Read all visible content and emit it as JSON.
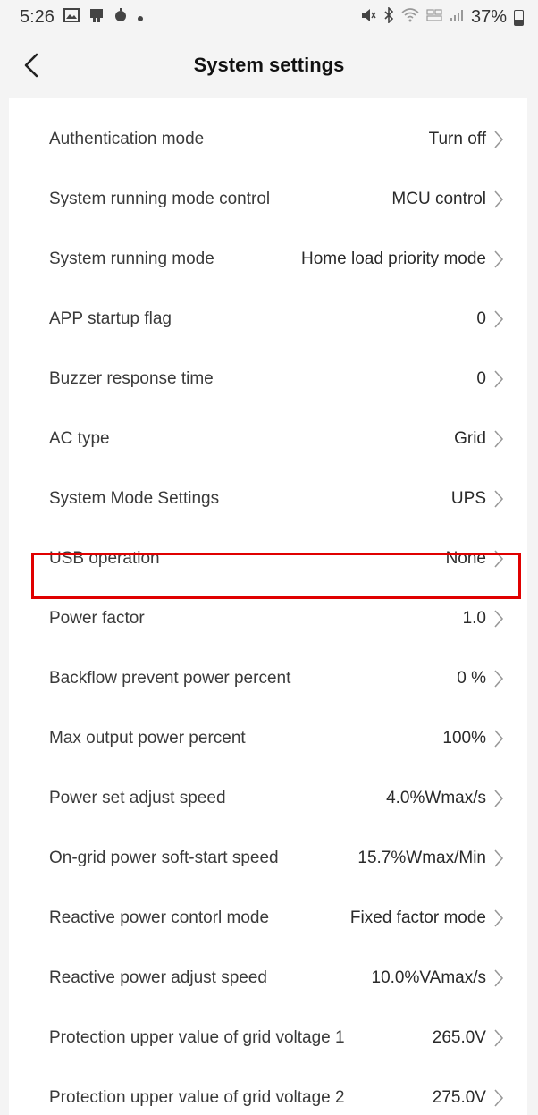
{
  "status_bar": {
    "time": "5:26",
    "battery": "37%",
    "left_icons": [
      "gallery-icon",
      "sim-icon",
      "alarm-clock-icon",
      "dot-icon"
    ],
    "right_icons": [
      "mute-icon",
      "bluetooth-icon",
      "wifi-icon",
      "volte-icon",
      "signal-icon",
      "battery-icon"
    ]
  },
  "header": {
    "title": "System settings",
    "back_icon": "chevron-left-icon"
  },
  "settings": [
    {
      "label": "Authentication mode",
      "value": "Turn off"
    },
    {
      "label": "System running mode control",
      "value": "MCU control"
    },
    {
      "label": "System running mode",
      "value": "Home load priority mode"
    },
    {
      "label": "APP startup flag",
      "value": "0"
    },
    {
      "label": "Buzzer response time",
      "value": "0"
    },
    {
      "label": "AC type",
      "value": "Grid"
    },
    {
      "label": "System Mode Settings",
      "value": "UPS"
    },
    {
      "label": "USB operation",
      "value": "None"
    },
    {
      "label": "Power factor",
      "value": "1.0"
    },
    {
      "label": "Backflow prevent power percent",
      "value": "0 %",
      "highlighted": true
    },
    {
      "label": "Max output power percent",
      "value": "100%"
    },
    {
      "label": "Power set adjust speed",
      "value": "4.0%Wmax/s"
    },
    {
      "label": "On-grid power soft-start speed",
      "value": "15.7%Wmax/Min"
    },
    {
      "label": "Reactive power contorl mode",
      "value": "Fixed factor mode"
    },
    {
      "label": "Reactive power adjust speed",
      "value": "10.0%VAmax/s"
    },
    {
      "label": "Protection upper value of grid voltage 1",
      "value": "265.0V"
    },
    {
      "label": "Protection upper value of grid voltage 2",
      "value": "275.0V"
    }
  ],
  "colors": {
    "highlight": "#e00000",
    "background": "#f4f4f4",
    "card": "#ffffff"
  }
}
